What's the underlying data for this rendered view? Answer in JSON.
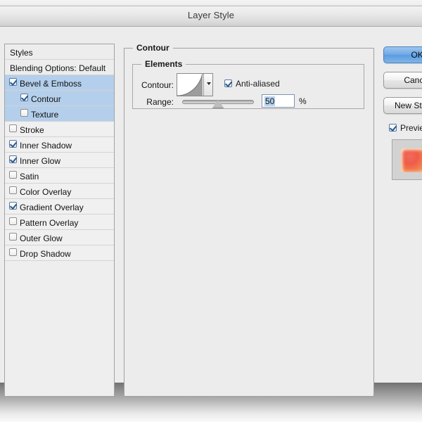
{
  "window": {
    "title": "Layer Style"
  },
  "sidebar": {
    "header_label": "Styles",
    "blending_options_label": "Blending Options: Default",
    "items": [
      {
        "label": "Bevel & Emboss",
        "checked": true,
        "selected": true,
        "indent": false
      },
      {
        "label": "Contour",
        "checked": true,
        "selected": true,
        "indent": true
      },
      {
        "label": "Texture",
        "checked": false,
        "selected": true,
        "indent": true
      },
      {
        "label": "Stroke",
        "checked": false,
        "selected": false,
        "indent": false
      },
      {
        "label": "Inner Shadow",
        "checked": true,
        "selected": false,
        "indent": false
      },
      {
        "label": "Inner Glow",
        "checked": true,
        "selected": false,
        "indent": false
      },
      {
        "label": "Satin",
        "checked": false,
        "selected": false,
        "indent": false
      },
      {
        "label": "Color Overlay",
        "checked": false,
        "selected": false,
        "indent": false
      },
      {
        "label": "Gradient Overlay",
        "checked": true,
        "selected": false,
        "indent": false
      },
      {
        "label": "Pattern Overlay",
        "checked": false,
        "selected": false,
        "indent": false
      },
      {
        "label": "Outer Glow",
        "checked": false,
        "selected": false,
        "indent": false
      },
      {
        "label": "Drop Shadow",
        "checked": false,
        "selected": false,
        "indent": false
      }
    ]
  },
  "contour_panel": {
    "group_title": "Contour",
    "elements_title": "Elements",
    "contour_label": "Contour:",
    "contour_swatch_name": "cone-contour-curve",
    "anti_aliased_label": "Anti-aliased",
    "anti_aliased_checked": true,
    "range_label": "Range:",
    "range_value": "50",
    "range_percent_symbol": "%",
    "range_slider_position_percent": 50
  },
  "buttons": {
    "ok_label": "OK",
    "cancel_label": "Cancel",
    "new_style_label": "New Style...",
    "preview_label": "Preview",
    "preview_checked": true
  },
  "colors": {
    "dialog_background": "#ececec",
    "selection_blue": "#b4cfeb",
    "primary_button_blue": "#70a8e4",
    "preview_swatch_red": "#ef5c48",
    "preview_swatch_orange": "#f5a65e",
    "border_gray": "#a0a0a0"
  }
}
